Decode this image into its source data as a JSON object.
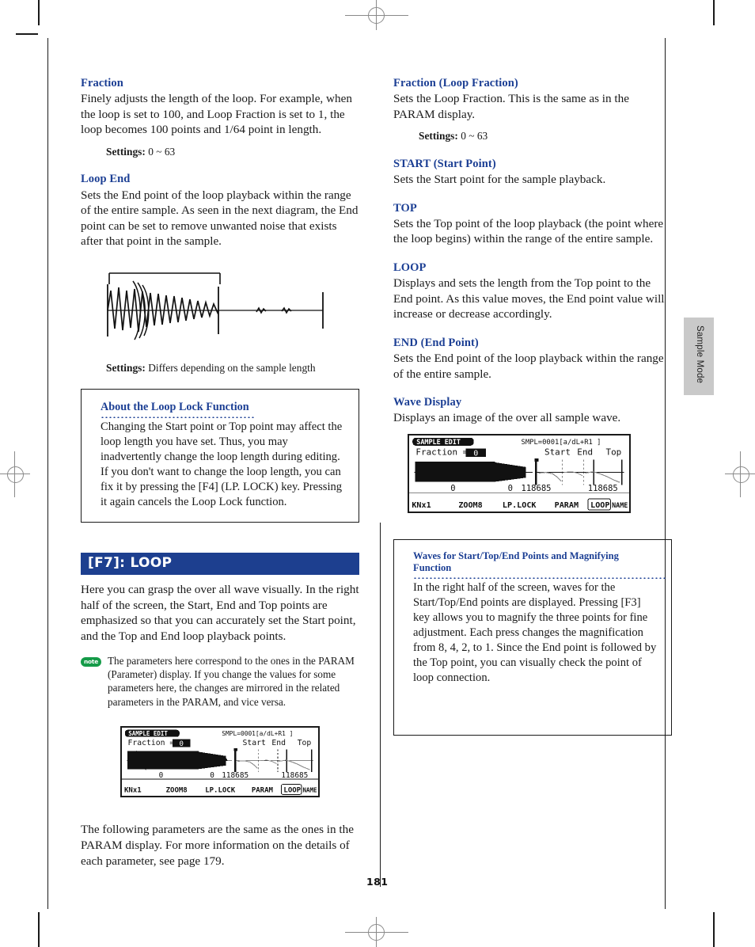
{
  "page": {
    "number": "181",
    "side_tab": "Sample Mode"
  },
  "left_column": {
    "sections": [
      {
        "heading": "Fraction",
        "body": "Finely adjusts the length of the loop. For example, when the loop is set to 100, and Loop Fraction is set to 1, the loop becomes 100 points and 1/64 point in length.",
        "settings_label": "Settings:",
        "settings_value": "0 ~ 63"
      },
      {
        "heading": "Loop End",
        "body": "Sets the End point of the loop playback within the range of the entire sample. As seen in the next diagram, the End point can be set to remove unwanted noise that exists after that point in the sample.",
        "settings_label": "Settings:",
        "settings_value": "Differs depending on the sample length"
      }
    ],
    "loop_lock_box": {
      "heading": "About the Loop Lock Function",
      "body": "Changing the Start point or Top point may affect the loop length you have set. Thus, you may inadvertently change the loop length during editing. If you don't want to change the loop length, you can fix it by pressing the [F4] (LP. LOCK) key. Pressing it again cancels the Loop Lock function."
    },
    "banner": "[F7]: LOOP",
    "banner_body": "Here you can grasp the over all wave visually. In the right half of the screen, the Start, End and Top points are emphasized so that you can accurately set the Start point, and the Top and End loop playback points.",
    "note": {
      "badge": "note",
      "text": "The parameters here correspond to the ones in the PARAM (Parameter) display. If you change the values for some parameters here, the changes are mirrored in the related parameters in the PARAM, and vice versa."
    },
    "closing_body": "The following parameters are the same as the ones in the PARAM display. For more information on the details of each parameter, see page 179."
  },
  "right_column": {
    "sections": [
      {
        "heading": "Fraction (Loop Fraction)",
        "body": "Sets the Loop Fraction. This is the same as in the PARAM display.",
        "settings_label": "Settings:",
        "settings_value": "0 ~ 63"
      },
      {
        "heading": "START (Start Point)",
        "body": "Sets the Start point for the sample playback.",
        "settings_label": "",
        "settings_value": ""
      },
      {
        "heading": "TOP",
        "body": "Sets the Top point of the loop playback (the point where the loop begins) within the range of the entire sample.",
        "settings_label": "",
        "settings_value": ""
      },
      {
        "heading": "LOOP",
        "body": "Displays and sets the length from the Top point to the End point. As this value moves, the End point value will increase or decrease accordingly.",
        "settings_label": "",
        "settings_value": ""
      },
      {
        "heading": "END (End Point)",
        "body": "Sets the End point of the loop playback within the range of the entire sample.",
        "settings_label": "",
        "settings_value": ""
      },
      {
        "heading": "Wave Display",
        "body": "Displays an image of the over all sample wave.",
        "settings_label": "",
        "settings_value": ""
      }
    ],
    "waves_box": {
      "heading": "Waves for Start/Top/End Points and Magnifying Function",
      "body": "In the right half of the screen, waves for the Start/Top/End points are displayed. Pressing [F3] key allows you to magnify the three points for fine adjustment. Each press changes the magnification from 8, 4, 2, to 1. Since the End point is followed by the Top point, you can visually check the point of loop connection."
    }
  },
  "lcd": {
    "tab_title": "SAMPLE EDIT",
    "sample_id": "SMPL=0001[a/dL+R1 ]",
    "param_label": "Fraction =",
    "param_value": "0",
    "col_labels": [
      "Start",
      "End",
      "Top"
    ],
    "values": [
      "0",
      "0",
      "118685",
      "118685"
    ],
    "function_keys": [
      "KNx1",
      "ZOOM8",
      "LP.LOCK",
      "PARAM",
      "LOOP",
      "NAME"
    ],
    "selected_function_key": "LOOP"
  },
  "colors": {
    "heading_blue": "#1c3f94",
    "banner_blue": "#1d3f8f",
    "note_green": "#159b48",
    "side_tab_gray": "#c9c9c9"
  }
}
